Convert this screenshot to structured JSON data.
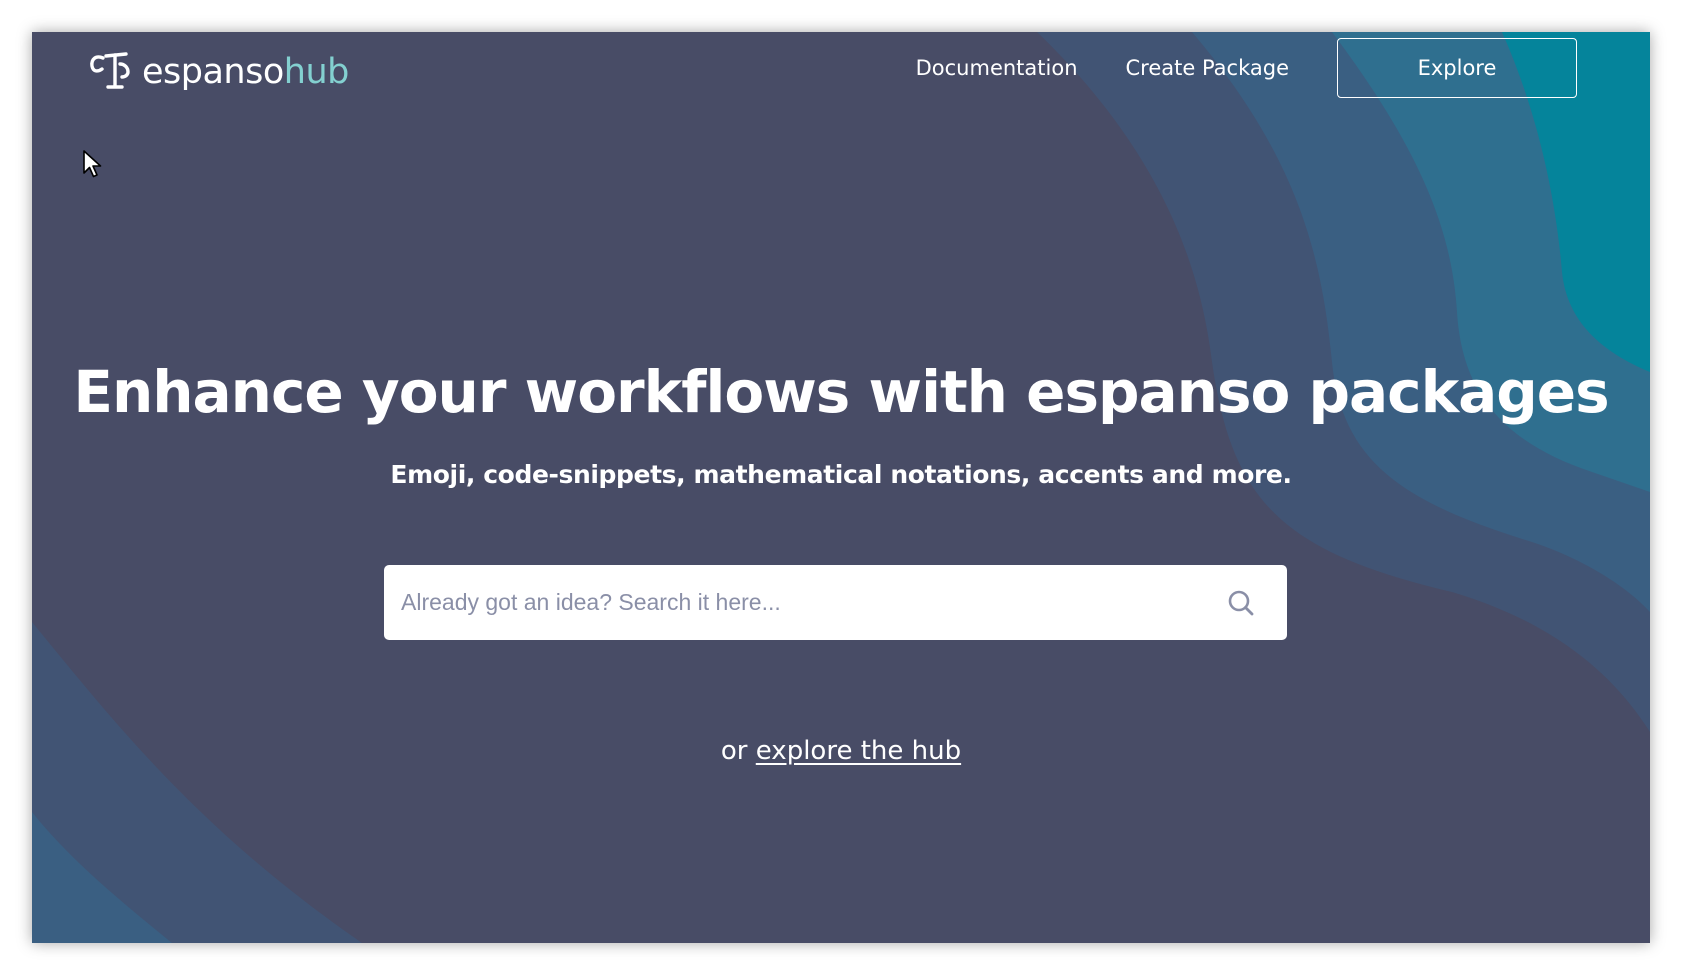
{
  "header": {
    "logo_main": "espanso",
    "logo_accent": "hub",
    "nav": {
      "documentation": "Documentation",
      "create_package": "Create Package",
      "explore": "Explore"
    }
  },
  "hero": {
    "title": "Enhance your workflows with espanso packages",
    "subtitle": "Emoji, code-snippets, mathematical notations, accents and more.",
    "search": {
      "value": "",
      "placeholder": "Already got an idea? Search it here..."
    },
    "explore_prefix": "or",
    "explore_link": "explore the hub"
  },
  "icons": {
    "logo": "espanso-logo-icon",
    "search": "search-icon",
    "cursor": "mouse-pointer-icon"
  },
  "colors": {
    "background": "#484c66",
    "wave_teal": "#05849b",
    "wave_blue_1": "#2f6f8f",
    "wave_blue_2": "#3a5f82",
    "wave_slate": "#415474",
    "logo_accent": "#83d0d0",
    "text": "#ffffff"
  }
}
